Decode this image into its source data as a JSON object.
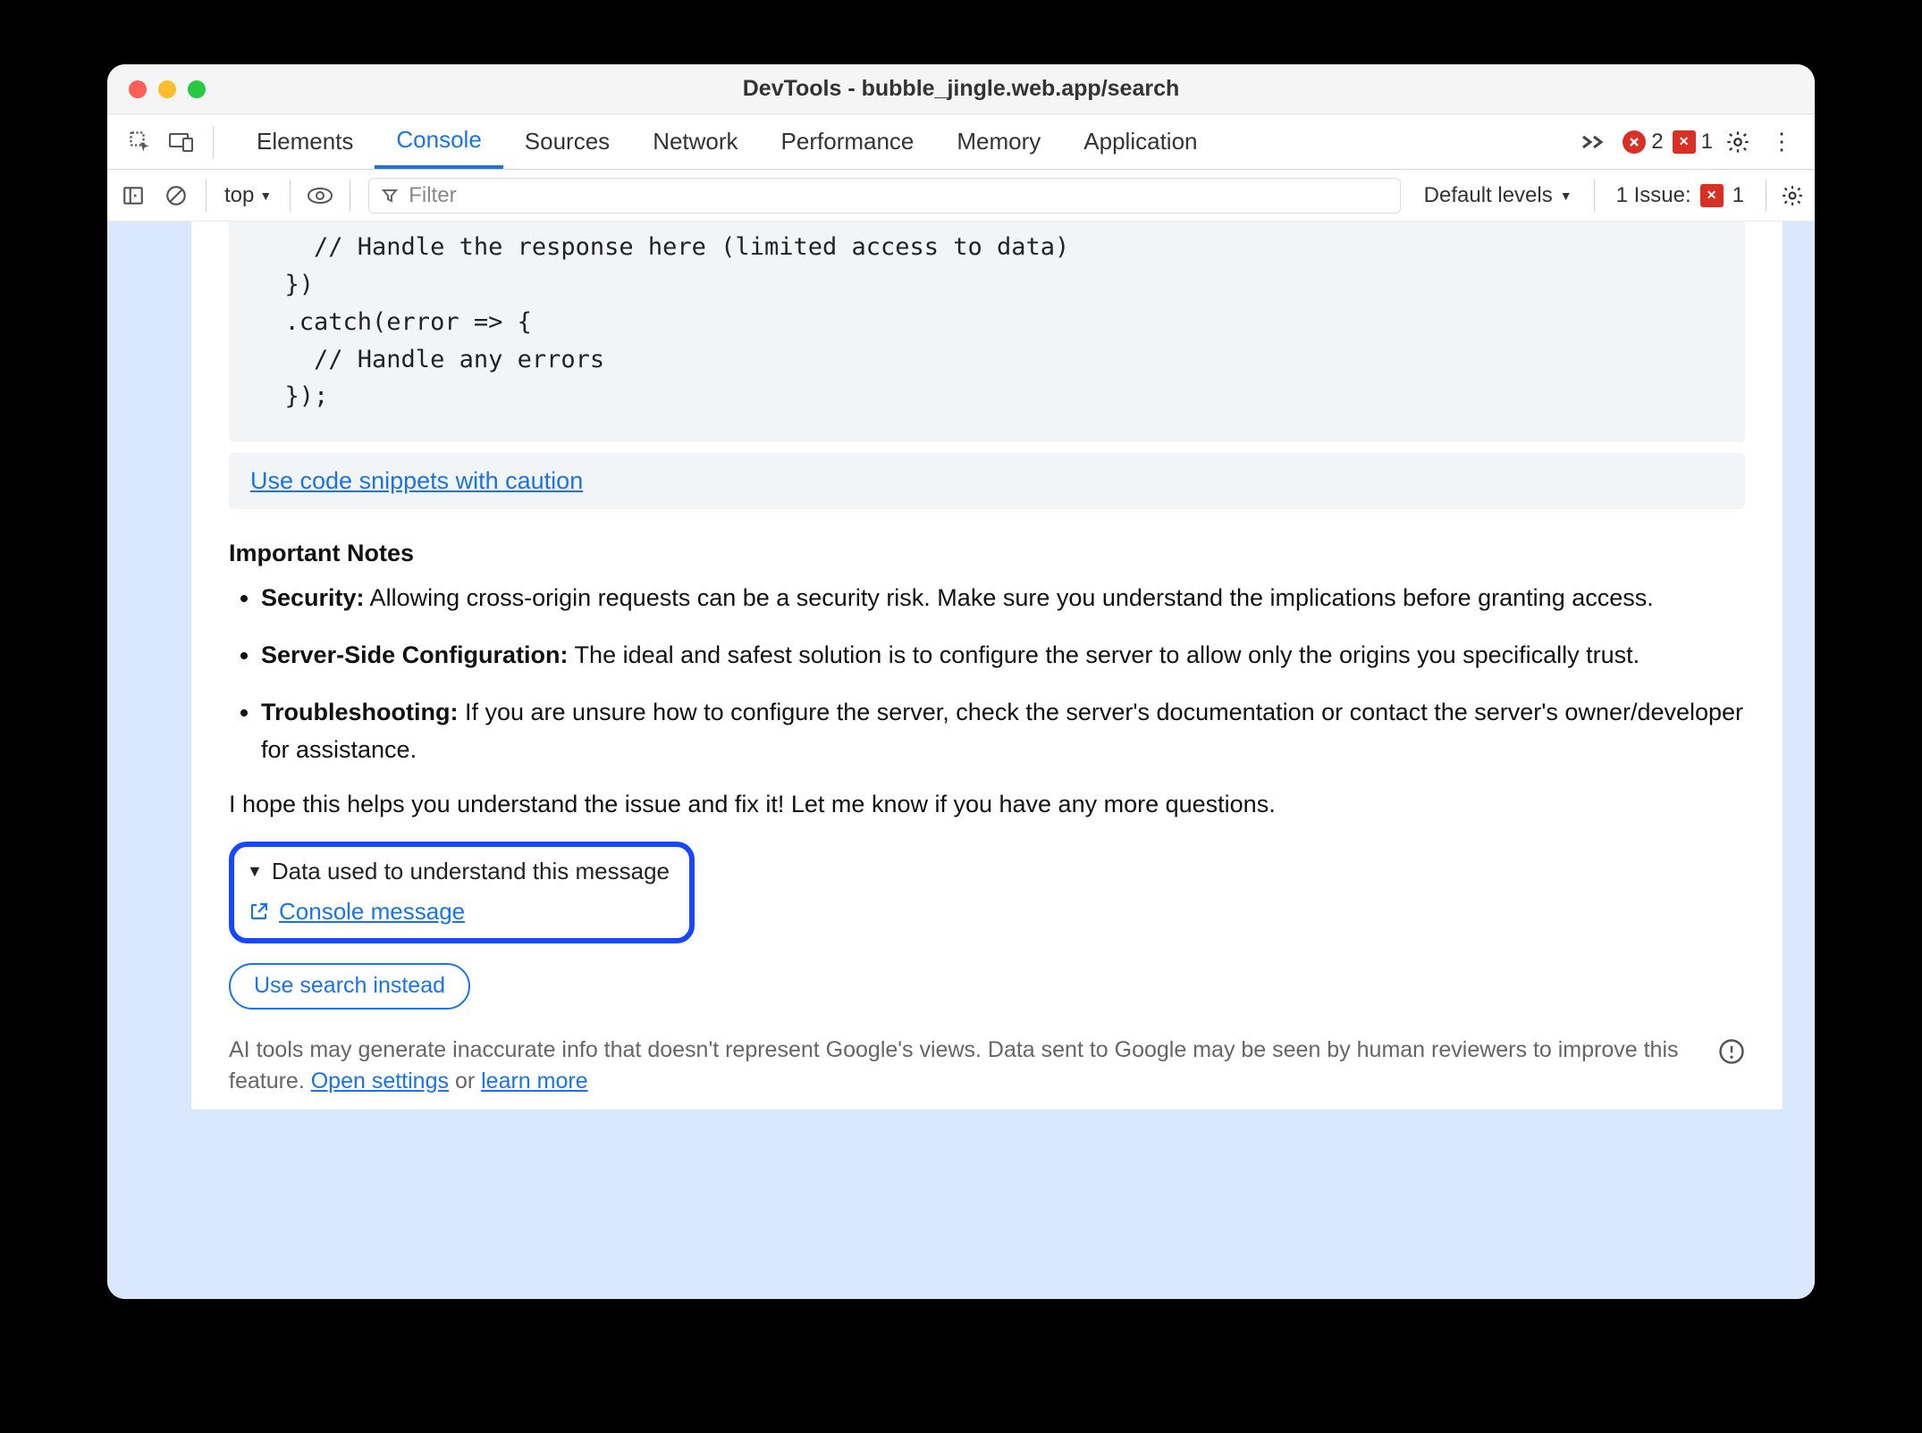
{
  "window": {
    "title": "DevTools - bubble_jingle.web.app/search"
  },
  "tabs": {
    "items": [
      "Elements",
      "Console",
      "Sources",
      "Network",
      "Performance",
      "Memory",
      "Application"
    ],
    "active_index": 1
  },
  "toolbar_right": {
    "error_count": "2",
    "issue_count": "1"
  },
  "subbar": {
    "context": "top",
    "filter_placeholder": "Filter",
    "levels": "Default levels",
    "issues_label": "1 Issue:",
    "issues_count": "1"
  },
  "content": {
    "code": "    // Handle the response here (limited access to data)\n  })\n  .catch(error => {\n    // Handle any errors\n  });",
    "caution_link": "Use code snippets with caution",
    "notes_heading": "Important Notes",
    "notes": [
      {
        "bold": "Security:",
        "text": " Allowing cross-origin requests can be a security risk. Make sure you understand the implications before granting access."
      },
      {
        "bold": "Server-Side Configuration:",
        "text": " The ideal and safest solution is to configure the server to allow only the origins you specifically trust."
      },
      {
        "bold": "Troubleshooting:",
        "text": " If you are unsure how to configure the server, check the server's documentation or contact the server's owner/developer for assistance."
      }
    ],
    "closing": "I hope this helps you understand the issue and fix it! Let me know if you have any more questions.",
    "data_used_summary": "Data used to understand this message",
    "console_message_link": "Console message",
    "suggest_button": "Use search instead",
    "disclaimer_pre": "AI tools may generate inaccurate info that doesn't represent Google's views. Data sent to Google may be seen by human reviewers to improve this feature. ",
    "disclaimer_link1": "Open settings",
    "disclaimer_mid": " or ",
    "disclaimer_link2": "learn more"
  }
}
